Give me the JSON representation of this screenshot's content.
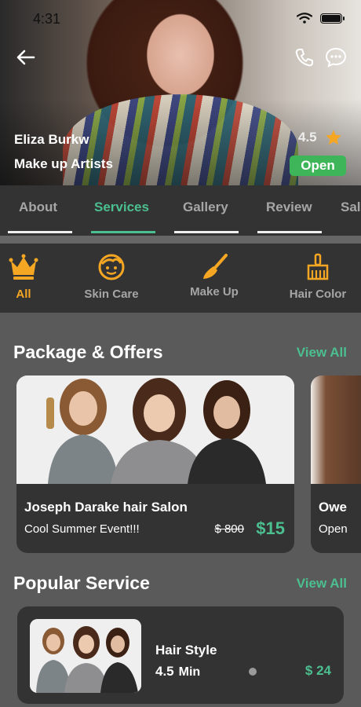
{
  "status_bar": {
    "time": "4:31"
  },
  "profile": {
    "name": "Eliza Burkw",
    "role": "Make up Artists",
    "rating": "4.5",
    "open_label": "Open"
  },
  "tabs": [
    {
      "label": "About",
      "active": false
    },
    {
      "label": "Services",
      "active": true
    },
    {
      "label": "Gallery",
      "active": false
    },
    {
      "label": "Review",
      "active": false
    },
    {
      "label": "Sal",
      "active": false
    }
  ],
  "categories": [
    {
      "label": "All",
      "icon": "crown-icon",
      "active": true
    },
    {
      "label": "Skin Care",
      "icon": "face-icon",
      "active": false
    },
    {
      "label": "Make Up",
      "icon": "makeup-brush-icon",
      "active": false
    },
    {
      "label": "Hair Color",
      "icon": "hair-brush-icon",
      "active": false
    }
  ],
  "packages": {
    "title": "Package & Offers",
    "view_all": "View All",
    "cards": [
      {
        "name": "Joseph Darake hair Salon",
        "subtitle": "Cool Summer Event!!!",
        "old_price": "$ 800",
        "new_price": "$15"
      },
      {
        "name": "Owe",
        "subtitle": "Open"
      }
    ]
  },
  "popular": {
    "title": "Popular Service",
    "view_all": "View All",
    "items": [
      {
        "name": "Hair Style",
        "rating": "4.5",
        "duration_unit": "Min",
        "price": "$ 24"
      }
    ]
  },
  "colors": {
    "accent_green": "#4bbf8f",
    "accent_orange": "#f5a623",
    "open_green": "#3fb55a",
    "panel": "#333333",
    "background": "#5a5a5a"
  }
}
